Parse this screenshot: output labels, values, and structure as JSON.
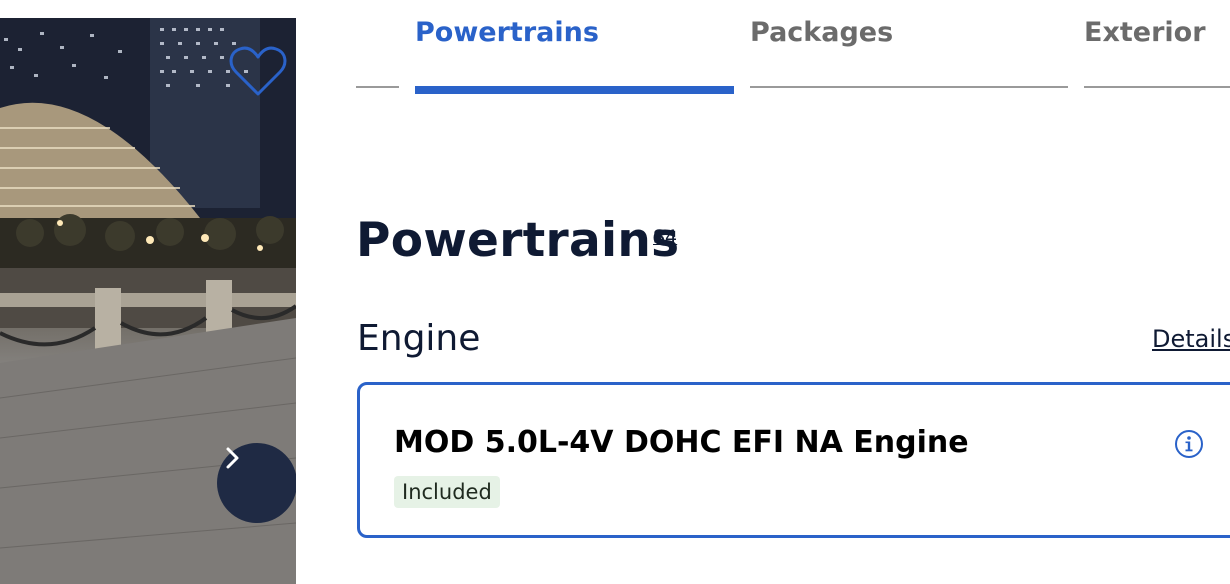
{
  "tabs": [
    {
      "label": "Powertrains",
      "active": true
    },
    {
      "label": "Packages",
      "active": false
    },
    {
      "label": "Exterior",
      "active": false
    }
  ],
  "page": {
    "title": "Powertrains",
    "footnote": "S4"
  },
  "section": {
    "title": "Engine",
    "details_link": "Details"
  },
  "option": {
    "name": "MOD 5.0L-4V DOHC EFI NA Engine",
    "price_badge": "Included",
    "selected": true
  },
  "icons": {
    "favorite": "heart-outline-icon",
    "next": "chevron-right-icon",
    "info": "info-circle-icon"
  },
  "colors": {
    "accent": "#2a62c9",
    "heading": "#0f1a33",
    "inactive_tab": "#6b6b6b",
    "badge_bg": "#e6f2e6",
    "nav_button": "#1f2a44"
  }
}
